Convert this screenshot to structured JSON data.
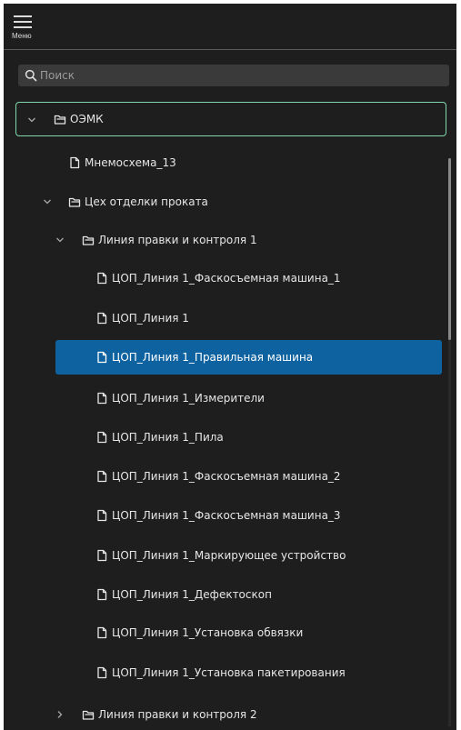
{
  "header": {
    "menu_label": "Меню"
  },
  "search": {
    "placeholder": "Поиск"
  },
  "tree": {
    "root": {
      "label": "ОЭМК",
      "expanded": true
    },
    "items": [
      {
        "label": "Мнемосхема_13",
        "type": "file"
      },
      {
        "label": "Цех отделки проката",
        "type": "folder",
        "expanded": true
      },
      {
        "label": "Линия правки и контроля 1",
        "type": "folder",
        "expanded": true
      },
      {
        "label": "ЦОП_Линия 1_Фаскосъемная машина_1",
        "type": "file"
      },
      {
        "label": "ЦОП_Линия 1",
        "type": "file"
      },
      {
        "label": "ЦОП_Линия 1_Правильная машина",
        "type": "file",
        "selected": true
      },
      {
        "label": "ЦОП_Линия 1_Измерители",
        "type": "file"
      },
      {
        "label": "ЦОП_Линия 1_Пила",
        "type": "file"
      },
      {
        "label": "ЦОП_Линия 1_Фаскосъемная машина_2",
        "type": "file"
      },
      {
        "label": "ЦОП_Линия 1_Фаскосъемная машина_3",
        "type": "file"
      },
      {
        "label": "ЦОП_Линия 1_Маркирующее устройство",
        "type": "file"
      },
      {
        "label": "ЦОП_Линия 1_Дефектоскоп",
        "type": "file"
      },
      {
        "label": "ЦОП_Линия 1_Установка обвязки",
        "type": "file"
      },
      {
        "label": "ЦОП_Линия 1_Установка пакетирования",
        "type": "file"
      },
      {
        "label": "Линия правки и контроля 2",
        "type": "folder",
        "expanded": false
      }
    ]
  },
  "colors": {
    "background": "#1e1e1e",
    "selected": "#0e62a0",
    "focus_outline": "#7fd7ab",
    "text": "#e6e6e6"
  },
  "icons": {
    "menu": "hamburger-icon",
    "search": "search-icon",
    "folder": "folder-icon",
    "file": "file-icon",
    "expanded": "chevron-down-icon",
    "collapsed": "chevron-right-icon"
  }
}
